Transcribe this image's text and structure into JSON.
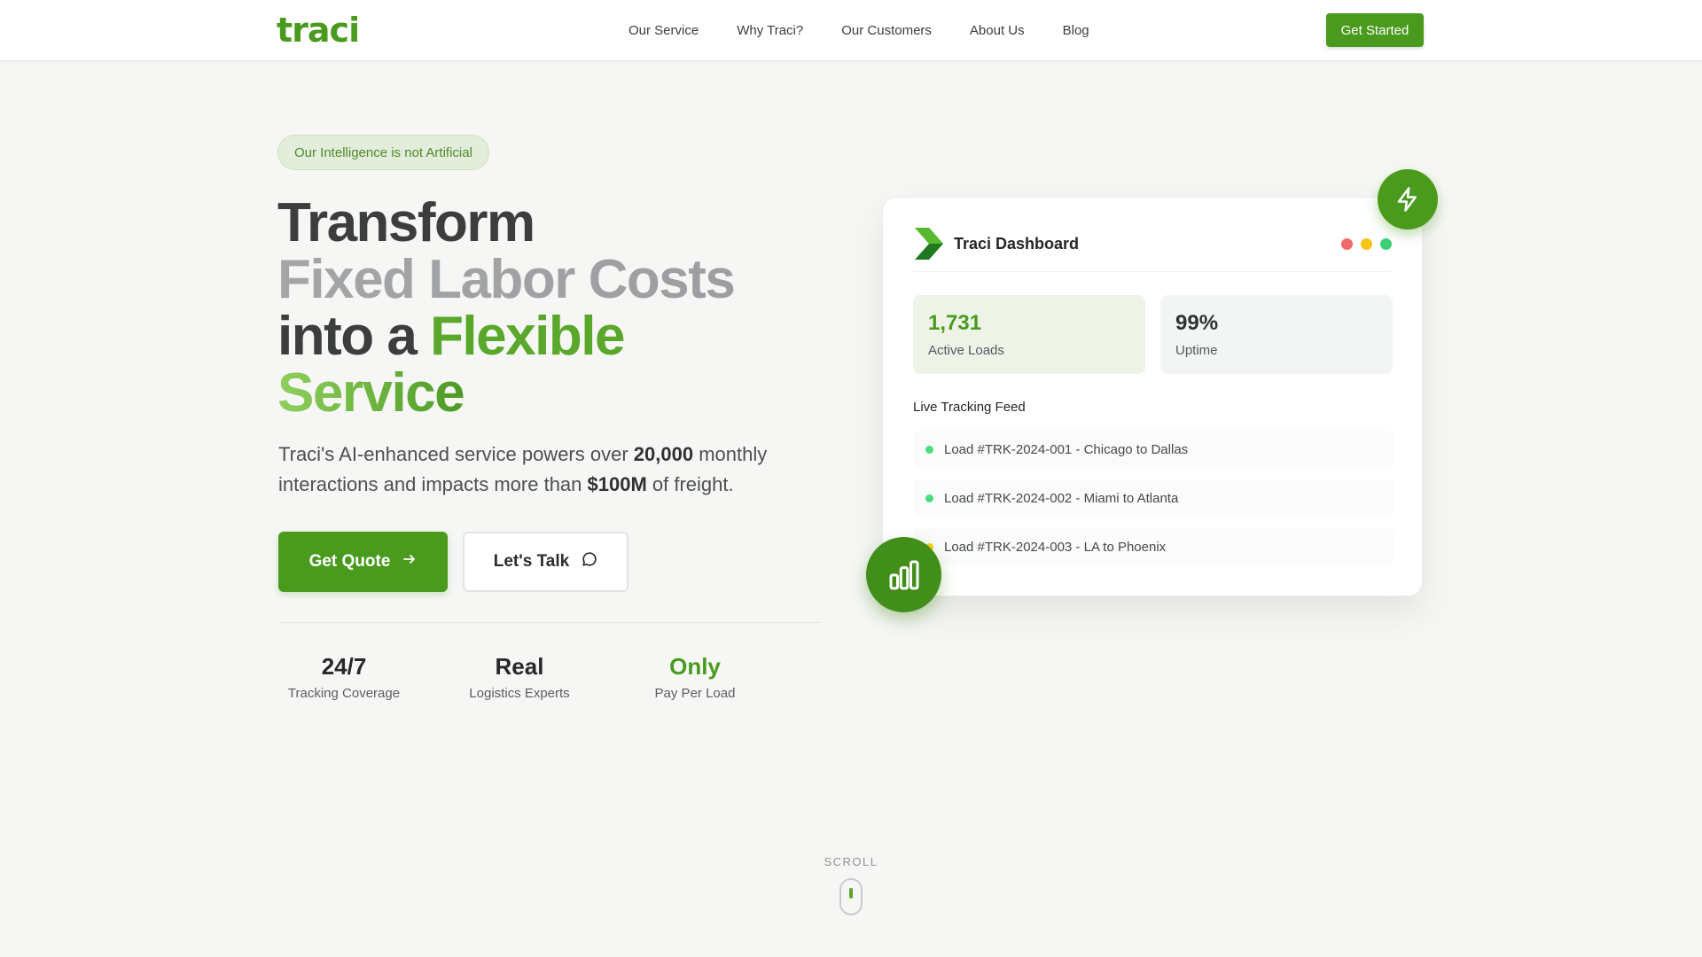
{
  "nav": {
    "logo": "traci",
    "links": [
      "Our Service",
      "Why Traci?",
      "Our Customers",
      "About Us",
      "Blog"
    ],
    "cta": "Get Started"
  },
  "hero": {
    "badge": "Our Intelligence is not Artificial",
    "headline": {
      "line1": "Transform",
      "line2": "Fixed Labor Costs",
      "line3_prefix": "into a ",
      "line3_accent": "Flexible",
      "line4": "Service"
    },
    "sub": {
      "part1": "Traci's AI-enhanced service powers over ",
      "bold1": "20,000",
      "part2": " monthly interactions and impacts more than ",
      "bold2": "$100M",
      "part3": " of freight."
    },
    "primary_button": "Get Quote",
    "secondary_button": "Let's Talk",
    "stats": [
      {
        "value": "24/7",
        "label": "Tracking Coverage"
      },
      {
        "value": "Real",
        "label": "Logistics Experts"
      },
      {
        "value": "Only",
        "label": "Pay Per Load"
      }
    ]
  },
  "dashboard": {
    "title": "Traci Dashboard",
    "metrics": [
      {
        "value": "1,731",
        "label": "Active Loads"
      },
      {
        "value": "99%",
        "label": "Uptime"
      }
    ],
    "feed_title": "Live Tracking Feed",
    "feed": [
      {
        "text": "Load #TRK-2024-001 - Chicago to Dallas",
        "status_color": "#4ade80"
      },
      {
        "text": "Load #TRK-2024-002 - Miami to Atlanta",
        "status_color": "#4ade80"
      },
      {
        "text": "Load #TRK-2024-003 - LA to Phoenix",
        "status_color": "#facc15"
      }
    ]
  },
  "scroll_label": "SCROLL",
  "colors": {
    "brand": "#4a9a1e",
    "dot_red": "#f26b6b",
    "dot_yellow": "#f5c518",
    "dot_green": "#3ccf78"
  },
  "icons": [
    "bolt-icon",
    "bar-chart-icon",
    "arrow-right-icon",
    "chat-bubble-icon",
    "chevron-logo-icon",
    "mouse-icon"
  ]
}
